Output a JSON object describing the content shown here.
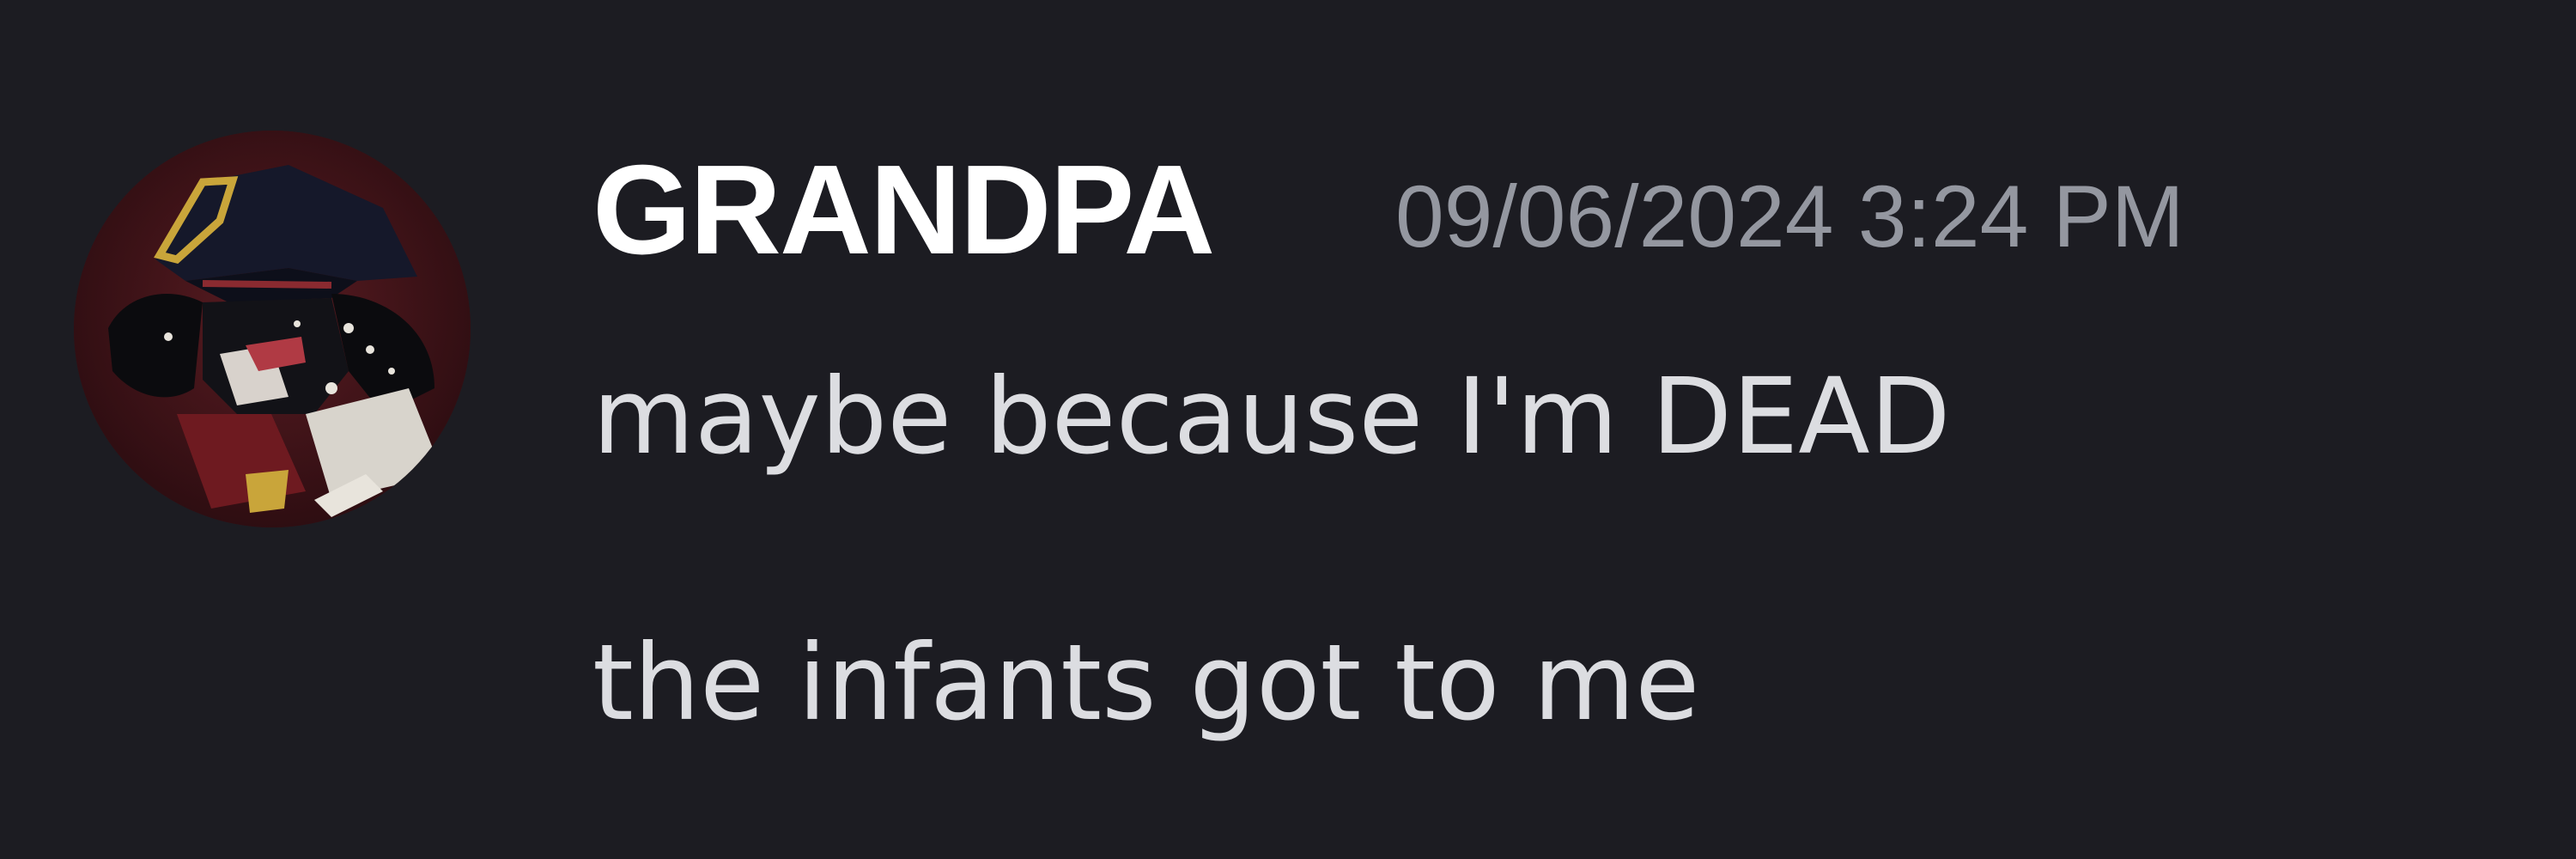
{
  "colors": {
    "background": "#1c1c22",
    "username": "#ffffff",
    "timestamp": "#9497a0",
    "message_text": "#dcdde1"
  },
  "message": {
    "avatar_icon": "avatar-image-icon",
    "username": "GRANDPA",
    "timestamp": "09/06/2024 3:24 PM",
    "lines": [
      "maybe because I'm DEAD",
      "the infants got to me"
    ]
  }
}
